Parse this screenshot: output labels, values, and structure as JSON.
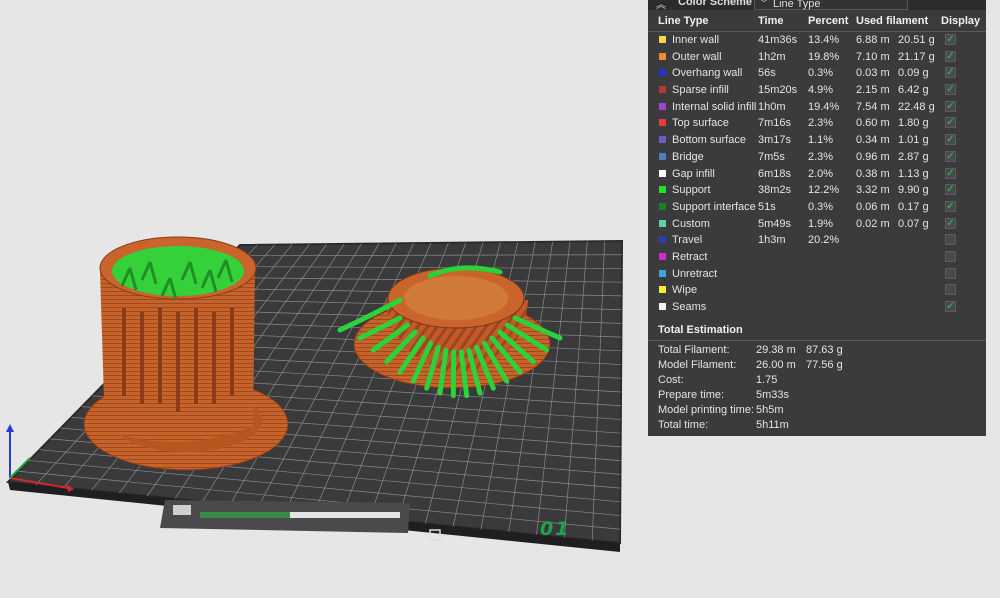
{
  "plate": {
    "label": "01"
  },
  "color_scheme": {
    "title": "Color Scheme",
    "selected": "Line Type"
  },
  "table": {
    "headers": {
      "line_type": "Line Type",
      "time": "Time",
      "percent": "Percent",
      "used_filament": "Used filament",
      "display": "Display"
    },
    "rows": [
      {
        "name": "Inner wall",
        "color": "#f5d64a",
        "time": "41m36s",
        "percent": "13.4%",
        "length": "6.88 m",
        "weight": "20.51 g",
        "checked": true,
        "has_checkbox": true
      },
      {
        "name": "Outer wall",
        "color": "#f08a2a",
        "time": "1h2m",
        "percent": "19.8%",
        "length": "7.10 m",
        "weight": "21.17 g",
        "checked": true,
        "has_checkbox": true
      },
      {
        "name": "Overhang wall",
        "color": "#2433c8",
        "time": "56s",
        "percent": "0.3%",
        "length": "0.03 m",
        "weight": "0.09 g",
        "checked": true,
        "has_checkbox": true
      },
      {
        "name": "Sparse infill",
        "color": "#b33a2f",
        "time": "15m20s",
        "percent": "4.9%",
        "length": "2.15 m",
        "weight": "6.42 g",
        "checked": true,
        "has_checkbox": true
      },
      {
        "name": "Internal solid infill",
        "color": "#9b46c8",
        "time": "1h0m",
        "percent": "19.4%",
        "length": "7.54 m",
        "weight": "22.48 g",
        "checked": true,
        "has_checkbox": true
      },
      {
        "name": "Top surface",
        "color": "#e83a3a",
        "time": "7m16s",
        "percent": "2.3%",
        "length": "0.60 m",
        "weight": "1.80 g",
        "checked": true,
        "has_checkbox": true
      },
      {
        "name": "Bottom surface",
        "color": "#6a5fc0",
        "time": "3m17s",
        "percent": "1.1%",
        "length": "0.34 m",
        "weight": "1.01 g",
        "checked": true,
        "has_checkbox": true
      },
      {
        "name": "Bridge",
        "color": "#4f7fb5",
        "time": "7m5s",
        "percent": "2.3%",
        "length": "0.96 m",
        "weight": "2.87 g",
        "checked": true,
        "has_checkbox": true
      },
      {
        "name": "Gap infill",
        "color": "#ffffff",
        "time": "6m18s",
        "percent": "2.0%",
        "length": "0.38 m",
        "weight": "1.13 g",
        "checked": true,
        "has_checkbox": true
      },
      {
        "name": "Support",
        "color": "#1fe02a",
        "time": "38m2s",
        "percent": "12.2%",
        "length": "3.32 m",
        "weight": "9.90 g",
        "checked": true,
        "has_checkbox": true
      },
      {
        "name": "Support interface",
        "color": "#1e7d25",
        "time": "51s",
        "percent": "0.3%",
        "length": "0.06 m",
        "weight": "0.17 g",
        "checked": true,
        "has_checkbox": true
      },
      {
        "name": "Custom",
        "color": "#5fd1a6",
        "time": "5m49s",
        "percent": "1.9%",
        "length": "0.02 m",
        "weight": "0.07 g",
        "checked": true,
        "has_checkbox": true
      },
      {
        "name": "Travel",
        "color": "#2b3fa6",
        "time": "1h3m",
        "percent": "20.2%",
        "length": "",
        "weight": "",
        "checked": false,
        "has_checkbox": true
      },
      {
        "name": "Retract",
        "color": "#d12ad4",
        "time": "",
        "percent": "",
        "length": "",
        "weight": "",
        "checked": false,
        "has_checkbox": true
      },
      {
        "name": "Unretract",
        "color": "#3aa6d8",
        "time": "",
        "percent": "",
        "length": "",
        "weight": "",
        "checked": false,
        "has_checkbox": true
      },
      {
        "name": "Wipe",
        "color": "#f6f02a",
        "time": "",
        "percent": "",
        "length": "",
        "weight": "",
        "checked": false,
        "has_checkbox": true
      },
      {
        "name": "Seams",
        "color": "#f2f2f2",
        "time": "",
        "percent": "",
        "length": "",
        "weight": "",
        "checked": true,
        "has_checkbox": true
      }
    ]
  },
  "total": {
    "title": "Total Estimation",
    "rows": [
      {
        "label": "Total Filament:",
        "v1": "29.38 m",
        "v2": "87.63 g"
      },
      {
        "label": "Model Filament:",
        "v1": "26.00 m",
        "v2": "77.56 g"
      },
      {
        "label": "Cost:",
        "v1": "1.75",
        "v2": ""
      },
      {
        "label": "Prepare time:",
        "v1": "5m33s",
        "v2": ""
      },
      {
        "label": "Model printing time:",
        "v1": "5h5m",
        "v2": ""
      },
      {
        "label": "Total time:",
        "v1": "5h11m",
        "v2": ""
      }
    ]
  }
}
